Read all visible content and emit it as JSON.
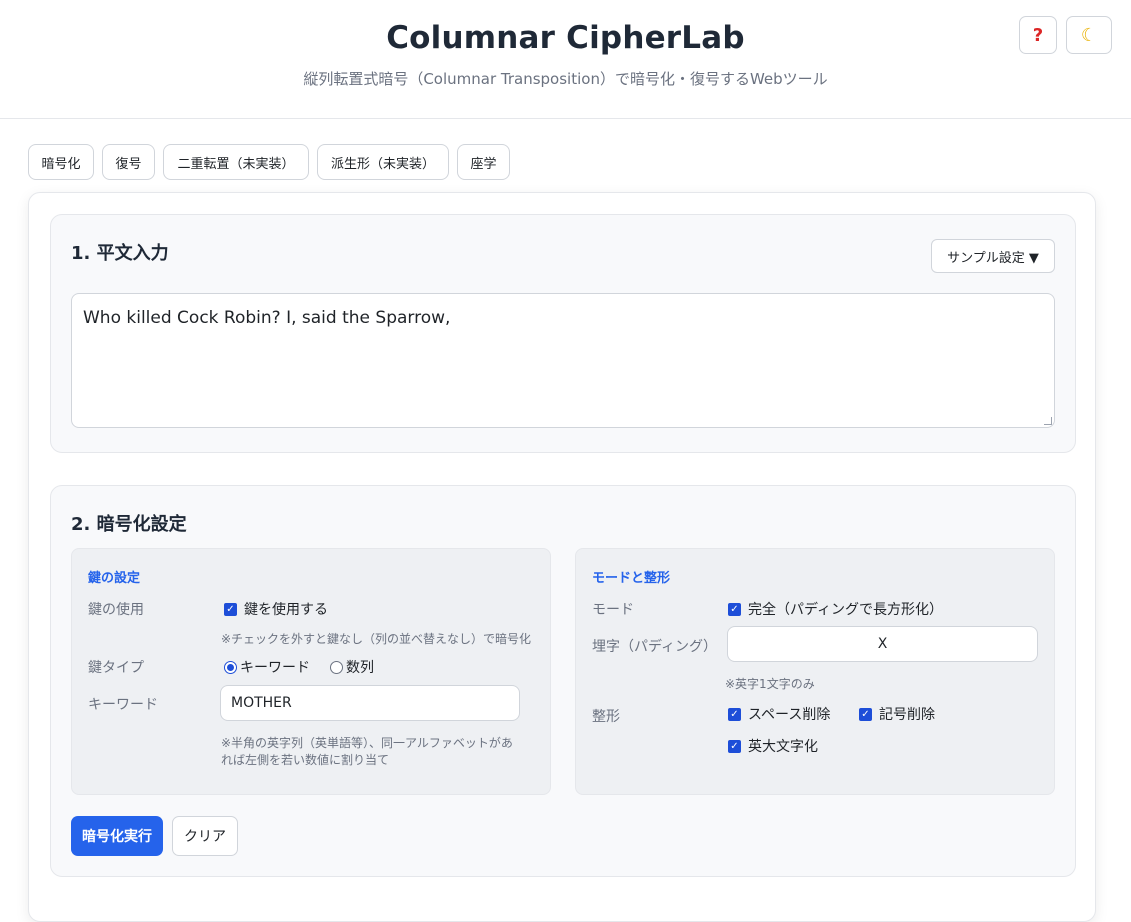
{
  "app": {
    "title": "Columnar CipherLab",
    "subtitle": "縦列転置式暗号（Columnar Transposition）で暗号化・復号するWebツール",
    "help_icon": "?",
    "theme_icon": "☾"
  },
  "tabs": [
    "暗号化",
    "復号",
    "二重転置（未実装）",
    "派生形（未実装）",
    "座学"
  ],
  "section1": {
    "title": "1. 平文入力",
    "sample_button": "サンプル設定 ▼",
    "plaintext": "Who killed Cock Robin? I, said the Sparrow,"
  },
  "section2": {
    "title": "2. 暗号化設定",
    "key_panel": {
      "title": "鍵の設定",
      "use_key_label": "鍵の使用",
      "use_key_checkbox": "鍵を使用する",
      "use_key_checked": true,
      "use_key_note": "※チェックを外すと鍵なし（列の並べ替えなし）で暗号化",
      "key_type_label": "鍵タイプ",
      "key_type_options": [
        "キーワード",
        "数列"
      ],
      "key_type_selected": "キーワード",
      "keyword_label": "キーワード",
      "keyword_value": "MOTHER",
      "keyword_note_line1": "※半角の英字列（英単語等）、同一アルファベットがあ",
      "keyword_note_line2": "れば左側を若い数値に割り当て"
    },
    "mode_panel": {
      "title": "モードと整形",
      "mode_label": "モード",
      "mode_checkbox": "完全（パディングで長方形化）",
      "mode_checked": true,
      "padding_label": "埋字（パディング）",
      "padding_value": "X",
      "padding_note": "※英字1文字のみ",
      "format_label": "整形",
      "format_options": [
        {
          "label": "スペース削除",
          "checked": true
        },
        {
          "label": "記号削除",
          "checked": true
        },
        {
          "label": "英大文字化",
          "checked": true
        }
      ]
    },
    "run_button": "暗号化実行",
    "clear_button": "クリア"
  },
  "colors": {
    "accent": "#2563eb",
    "checkbox": "#1d4ed8",
    "panel_bg": "#eef0f3",
    "section_bg": "#f8f9fb"
  }
}
